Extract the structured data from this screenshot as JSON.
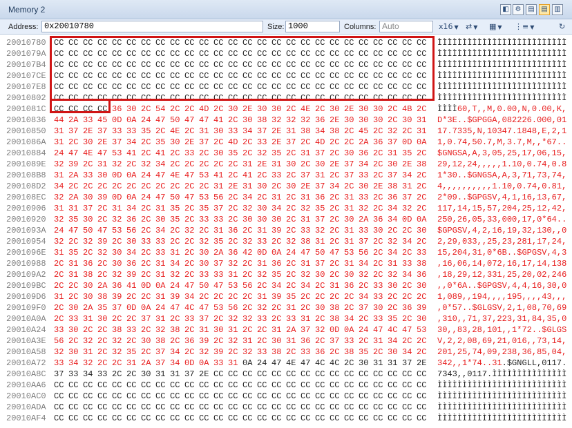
{
  "window": {
    "title": "Memory 2"
  },
  "toolbar": {
    "address_label": "Address:",
    "address_value": "0x20010780",
    "size_label": "Size:",
    "size_value": "1000",
    "columns_label": "Columns:",
    "columns_placeholder": "Auto",
    "format_label": "x16",
    "icons": [
      "endianness-icon",
      "column-layout-icon",
      "data-format-icon",
      "refresh-icon"
    ]
  },
  "rows": [
    {
      "addr": "20010780",
      "bytes": "CC CC CC CC CC CC CC CC CC CC CC CC CC CC CC CC CC CC CC CC CC CC CC CC CC CC",
      "ascii": "ÌÌÌÌÌÌÌÌÌÌÌÌÌÌÌÌÌÌÌÌÌÌÌÌÌÌ",
      "changed_from": 26
    },
    {
      "addr": "2001079A",
      "bytes": "CC CC CC CC CC CC CC CC CC CC CC CC CC CC CC CC CC CC CC CC CC CC CC CC CC CC",
      "ascii": "ÌÌÌÌÌÌÌÌÌÌÌÌÌÌÌÌÌÌÌÌÌÌÌÌÌÌ",
      "changed_from": 26
    },
    {
      "addr": "200107B4",
      "bytes": "CC CC CC CC CC CC CC CC CC CC CC CC CC CC CC CC CC CC CC CC CC CC CC CC CC CC",
      "ascii": "ÌÌÌÌÌÌÌÌÌÌÌÌÌÌÌÌÌÌÌÌÌÌÌÌÌÌ",
      "changed_from": 26
    },
    {
      "addr": "200107CE",
      "bytes": "CC CC CC CC CC CC CC CC CC CC CC CC CC CC CC CC CC CC CC CC CC CC CC CC CC CC",
      "ascii": "ÌÌÌÌÌÌÌÌÌÌÌÌÌÌÌÌÌÌÌÌÌÌÌÌÌÌ",
      "changed_from": 26
    },
    {
      "addr": "200107E8",
      "bytes": "CC CC CC CC CC CC CC CC CC CC CC CC CC CC CC CC CC CC CC CC CC CC CC CC CC CC",
      "ascii": "ÌÌÌÌÌÌÌÌÌÌÌÌÌÌÌÌÌÌÌÌÌÌÌÌÌÌ",
      "changed_from": 26
    },
    {
      "addr": "20010802",
      "bytes": "CC CC CC CC CC CC CC CC CC CC CC CC CC CC CC CC CC CC CC CC CC CC CC CC CC CC",
      "ascii": "ÌÌÌÌÌÌÌÌÌÌÌÌÌÌÌÌÌÌÌÌÌÌÌÌÌÌ",
      "changed_from": 26
    },
    {
      "addr": "2001081C",
      "bytes": "CC CC CC CC 36 30 2C 54 2C 2C 4D 2C 30 2E 30 30 2C 4E 2C 30 2E 30 30 2C 4B 2C",
      "ascii": "ÌÌÌÌ60,T,,M,0.00,N,0.00,K,",
      "changed_from": 4
    },
    {
      "addr": "20010836",
      "bytes": "44 2A 33 45 0D 0A 24 47 50 47 47 41 2C 30 38 32 32 32 36 2E 30 30 30 2C 30 31",
      "ascii": "D*3E..$GPGGA,082226.000,01",
      "changed_from": 0
    },
    {
      "addr": "20010850",
      "bytes": "31 37 2E 37 33 33 35 2C 4E 2C 31 30 33 34 37 2E 31 38 34 38 2C 45 2C 32 2C 31",
      "ascii": "17.7335,N,10347.1848,E,2,1",
      "changed_from": 0
    },
    {
      "addr": "2001086A",
      "bytes": "31 2C 30 2E 37 34 2C 35 30 2E 37 2C 4D 2C 33 2E 37 2C 4D 2C 2C 2A 36 37 0D 0A",
      "ascii": "1,0.74,50.7,M,3.7,M,,*67..",
      "changed_from": 0
    },
    {
      "addr": "20010884",
      "bytes": "24 47 4E 47 53 41 2C 41 2C 33 2C 30 35 2C 32 35 2C 31 37 2C 30 36 2C 31 35 2C",
      "ascii": "$GNGSA,A,3,05,25,17,06,15,",
      "changed_from": 0
    },
    {
      "addr": "2001089E",
      "bytes": "32 39 2C 31 32 2C 32 34 2C 2C 2C 2C 2C 31 2E 31 30 2C 30 2E 37 34 2C 30 2E 38",
      "ascii": "29,12,24,,,,,1.10,0.74,0.8",
      "changed_from": 0
    },
    {
      "addr": "200108B8",
      "bytes": "31 2A 33 30 0D 0A 24 47 4E 47 53 41 2C 41 2C 33 2C 37 31 2C 37 33 2C 37 34 2C",
      "ascii": "1*30..$GNGSA,A,3,71,73,74,",
      "changed_from": 0
    },
    {
      "addr": "200108D2",
      "bytes": "34 2C 2C 2C 2C 2C 2C 2C 2C 2C 2C 31 2E 31 30 2C 30 2E 37 34 2C 30 2E 38 31 2C",
      "ascii": "4,,,,,,,,,,1.10,0.74,0.81,",
      "changed_from": 0
    },
    {
      "addr": "200108EC",
      "bytes": "32 2A 30 39 0D 0A 24 47 50 47 53 56 2C 34 2C 31 2C 31 36 2C 31 33 2C 36 37 2C",
      "ascii": "2*09..$GPGSV,4,1,16,13,67,",
      "changed_from": 0
    },
    {
      "addr": "20010906",
      "bytes": "31 31 37 2C 31 34 2C 31 35 2C 35 37 2C 32 30 34 2C 32 35 2C 31 32 2C 34 32 2C",
      "ascii": "117,14,15,57,204,25,12,42,",
      "changed_from": 0
    },
    {
      "addr": "20010920",
      "bytes": "32 35 30 2C 32 36 2C 30 35 2C 33 33 2C 30 30 30 2C 31 37 2C 30 2A 36 34 0D 0A",
      "ascii": "250,26,05,33,000,17,0*64..",
      "changed_from": 0
    },
    {
      "addr": "2001093A",
      "bytes": "24 47 50 47 53 56 2C 34 2C 32 2C 31 36 2C 31 39 2C 33 32 2C 31 33 30 2C 2C 30",
      "ascii": "$GPGSV,4,2,16,19,32,130,,0",
      "changed_from": 0
    },
    {
      "addr": "20010954",
      "bytes": "32 2C 32 39 2C 30 33 33 2C 2C 32 35 2C 32 33 2C 32 38 31 2C 31 37 2C 32 34 2C",
      "ascii": "2,29,033,,25,23,281,17,24,",
      "changed_from": 0
    },
    {
      "addr": "2001096E",
      "bytes": "31 35 2C 32 30 34 2C 33 31 2C 30 2A 36 42 0D 0A 24 47 50 47 53 56 2C 34 2C 33",
      "ascii": "15,204,31,0*6B..$GPGSV,4,3",
      "changed_from": 0
    },
    {
      "addr": "20010988",
      "bytes": "2C 31 36 2C 30 36 2C 31 34 2C 30 37 32 2C 31 36 2C 31 37 2C 31 34 2C 31 33 38",
      "ascii": ",16,06,14,072,16,17,14,138",
      "changed_from": 0
    },
    {
      "addr": "200109A2",
      "bytes": "2C 31 38 2C 32 39 2C 31 32 2C 33 33 31 2C 32 35 2C 32 30 2C 30 32 2C 32 34 36",
      "ascii": ",18,29,12,331,25,20,02,246",
      "changed_from": 0
    },
    {
      "addr": "200109BC",
      "bytes": "2C 2C 30 2A 36 41 0D 0A 24 47 50 47 53 56 2C 34 2C 34 2C 31 36 2C 33 30 2C 30",
      "ascii": ",,0*6A..$GPGSV,4,4,16,30,0",
      "changed_from": 0
    },
    {
      "addr": "200109D6",
      "bytes": "31 2C 30 38 39 2C 2C 31 39 34 2C 2C 2C 2C 31 39 35 2C 2C 2C 2C 34 33 2C 2C 2C",
      "ascii": "1,089,,194,,,,195,,,,43,,,",
      "changed_from": 0
    },
    {
      "addr": "200109F0",
      "bytes": "2C 30 2A 35 37 0D 0A 24 47 4C 47 53 56 2C 32 2C 31 2C 30 38 2C 37 30 2C 36 39",
      "ascii": ",0*57..$GLGSV,2,1,08,70,69",
      "changed_from": 0
    },
    {
      "addr": "20010A0A",
      "bytes": "2C 33 31 30 2C 2C 37 31 2C 33 37 2C 32 32 33 2C 33 31 2C 38 34 2C 33 35 2C 30",
      "ascii": ",310,,71,37,223,31,84,35,0",
      "changed_from": 0
    },
    {
      "addr": "20010A24",
      "bytes": "33 30 2C 2C 38 33 2C 32 38 2C 31 30 31 2C 2C 31 2A 37 32 0D 0A 24 47 4C 47 53",
      "ascii": "30,,83,28,101,,1*72..$GLGS",
      "changed_from": 0
    },
    {
      "addr": "20010A3E",
      "bytes": "56 2C 32 2C 32 2C 30 38 2C 36 39 2C 32 31 2C 30 31 36 2C 37 33 2C 31 34 2C 2C",
      "ascii": "V,2,2,08,69,21,016,,73,14,",
      "changed_from": 0
    },
    {
      "addr": "20010A58",
      "bytes": "32 30 31 2C 32 35 2C 37 34 2C 32 39 2C 32 33 38 2C 33 36 2C 38 35 2C 30 34 2C",
      "ascii": "201,25,74,09,238,36,85,04,",
      "changed_from": 0
    },
    {
      "addr": "20010A72",
      "bytes": "33 34 32 2C 2C 31 2A 37 34 0D 0A 33 31 0A 24 47 4E 47 4C 4C 2C 30 31 31 37 2E",
      "ascii": "342,,1*74..31.$GNGLL,0117.",
      "changed_from": 0,
      "changed_until": 13
    },
    {
      "addr": "20010A8C",
      "bytes": "37 33 34 33 2C 2C 30 31 31 37 2E CC CC CC CC CC CC CC CC CC CC CC CC CC CC CC",
      "ascii": "7343,,0117.ÌÌÌÌÌÌÌÌÌÌÌÌÌÌÌ",
      "changed_from": 26
    },
    {
      "addr": "20010AA6",
      "bytes": "CC CC CC CC CC CC CC CC CC CC CC CC CC CC CC CC CC CC CC CC CC CC CC CC CC CC",
      "ascii": "ÌÌÌÌÌÌÌÌÌÌÌÌÌÌÌÌÌÌÌÌÌÌÌÌÌÌ",
      "changed_from": 26
    },
    {
      "addr": "20010AC0",
      "bytes": "CC CC CC CC CC CC CC CC CC CC CC CC CC CC CC CC CC CC CC CC CC CC CC CC CC CC",
      "ascii": "ÌÌÌÌÌÌÌÌÌÌÌÌÌÌÌÌÌÌÌÌÌÌÌÌÌÌ",
      "changed_from": 26
    },
    {
      "addr": "20010ADA",
      "bytes": "CC CC CC CC CC CC CC CC CC CC CC CC CC CC CC CC CC CC CC CC CC CC CC CC CC CC",
      "ascii": "ÌÌÌÌÌÌÌÌÌÌÌÌÌÌÌÌÌÌÌÌÌÌÌÌÌÌ",
      "changed_from": 26
    },
    {
      "addr": "20010AF4",
      "bytes": "CC CC CC CC CC CC CC CC CC CC CC CC CC CC CC CC CC CC CC CC CC CC CC CC CC CC",
      "ascii": "ÌÌÌÌÌÌÌÌÌÌÌÌÌÌÌÌÌÌÌÌÌÌÌÌÌÌ",
      "changed_from": 26
    }
  ],
  "colors": {
    "changed": "#e81c1c",
    "normal": "#222222",
    "address": "#7f7f7f",
    "highlight": "#d01414"
  }
}
